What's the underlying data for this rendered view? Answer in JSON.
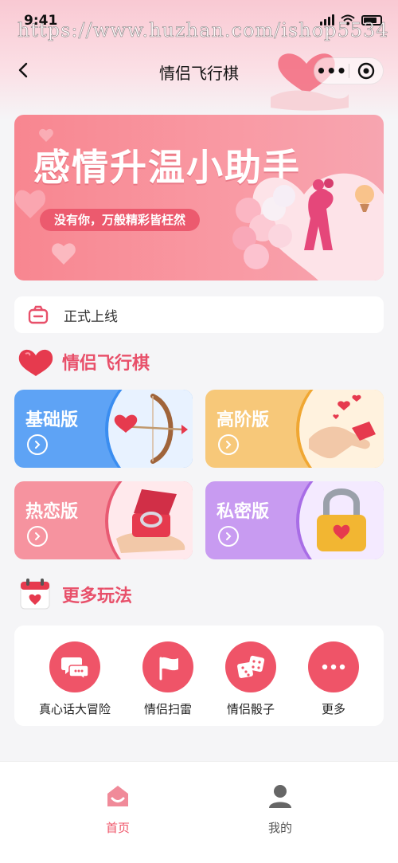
{
  "status": {
    "time": "9:41"
  },
  "watermark": "https://www.huzhan.com/ishop5534",
  "nav": {
    "title": "情侣飞行棋",
    "more_icon": "more-dots-icon",
    "close_icon": "target-icon"
  },
  "banner": {
    "title": "感情升温小助手",
    "subtitle": "没有你，万般精彩皆枉然"
  },
  "notice": {
    "text": "正式上线"
  },
  "section_game": {
    "title": "情侣飞行棋"
  },
  "versions": [
    {
      "label": "基础版",
      "color": "#5ea3f5",
      "circle": "#e8f2ff",
      "ring": "#3a8df0"
    },
    {
      "label": "高阶版",
      "color": "#f7c879",
      "circle": "#fff2de",
      "ring": "#f0a732"
    },
    {
      "label": "热恋版",
      "color": "#f6939f",
      "circle": "#ffe9ec",
      "ring": "#e85a72"
    },
    {
      "label": "私密版",
      "color": "#c89bf1",
      "circle": "#f4eaff",
      "ring": "#a86de6"
    }
  ],
  "section_more": {
    "title": "更多玩法"
  },
  "more": [
    {
      "label": "真心话大冒险",
      "icon": "chat-bubbles-icon"
    },
    {
      "label": "情侣扫雷",
      "icon": "flag-icon"
    },
    {
      "label": "情侣骰子",
      "icon": "dice-icon"
    },
    {
      "label": "更多",
      "icon": "more-dots-icon"
    }
  ],
  "tabs": [
    {
      "label": "首页",
      "icon": "home-icon",
      "active": true,
      "color": "#ef5468"
    },
    {
      "label": "我的",
      "icon": "user-icon",
      "active": false,
      "color": "#555555"
    }
  ]
}
